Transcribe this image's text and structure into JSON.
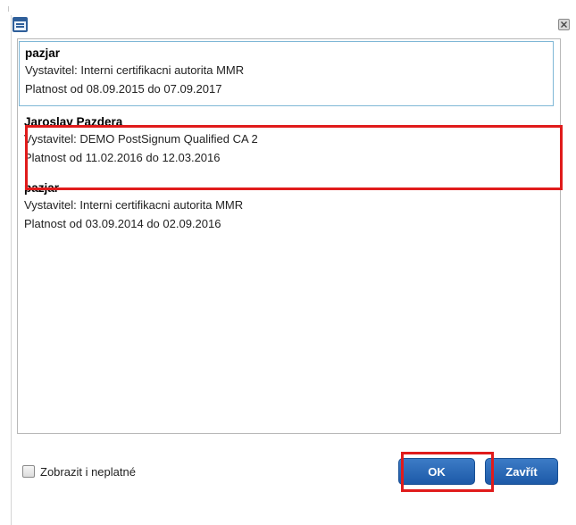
{
  "window": {
    "icon": "window-list-icon",
    "close_icon": "close-icon"
  },
  "certificates": [
    {
      "name": "pazjar",
      "issuer": "Vystavitel: Interni certifikacni autorita MMR",
      "validity": "Platnost od 08.09.2015 do 07.09.2017",
      "selected": true
    },
    {
      "name": "Jaroslav Pazdera",
      "issuer": "Vystavitel: DEMO PostSignum Qualified CA 2",
      "validity": "Platnost od 11.02.2016 do 12.03.2016",
      "selected": false
    },
    {
      "name": "pazjar",
      "issuer": "Vystavitel: Interni certifikacni autorita MMR",
      "validity": "Platnost od 03.09.2014 do 02.09.2016",
      "selected": false
    }
  ],
  "footer": {
    "show_invalid_label": "Zobrazit i neplatné",
    "show_invalid_checked": false,
    "ok_label": "OK",
    "close_label": "Zavřít"
  },
  "colors": {
    "button_blue": "#1d5aa8",
    "highlight_red": "#e01b1b",
    "selection_border": "#7fb7d6"
  }
}
